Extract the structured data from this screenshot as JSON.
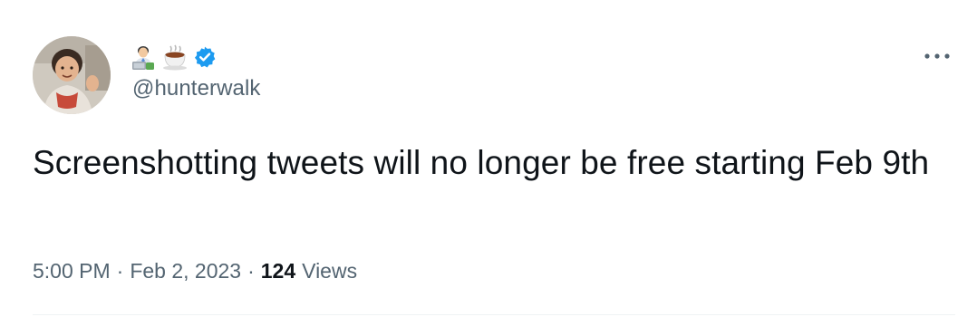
{
  "tweet": {
    "handle": "@hunterwalk",
    "display_name_icons": [
      "technologist-icon",
      "coffee-icon"
    ],
    "verified": true,
    "text": "Screenshotting tweets will no longer be free starting Feb 9th",
    "time": "5:00 PM",
    "separator": "·",
    "date": "Feb 2, 2023",
    "views_count": "124",
    "views_label": "Views"
  },
  "colors": {
    "text_primary": "#0f1419",
    "text_secondary": "#536471",
    "verified_blue": "#1d9bf0"
  }
}
